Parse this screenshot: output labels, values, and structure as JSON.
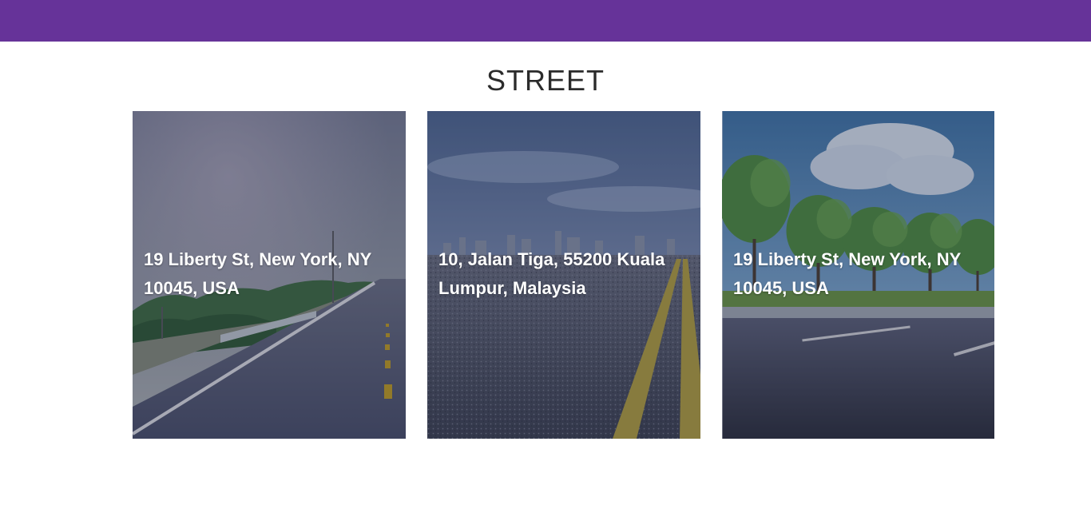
{
  "header": {
    "color": "#663399"
  },
  "section": {
    "title": "STREET"
  },
  "cards": [
    {
      "address": "19 Liberty St, New York, NY 10045, USA",
      "image": "road-with-hazy-sky"
    },
    {
      "address": "10, Jalan Tiga, 55200 Kuala Lumpur, Malaysia",
      "image": "asphalt-road-with-city-skyline"
    },
    {
      "address": "19 Liberty St, New York, NY 10045, USA",
      "image": "road-with-trees-and-clouds"
    }
  ]
}
